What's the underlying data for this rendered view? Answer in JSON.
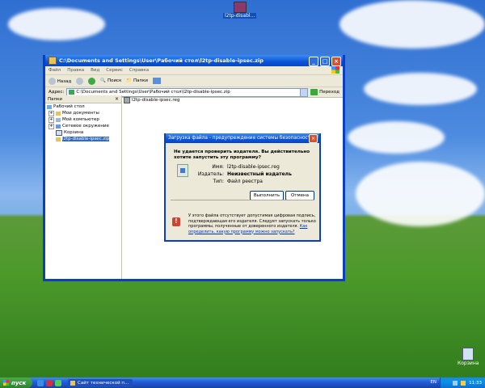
{
  "desktop": {
    "top_icon_label": "l2tp-disabl...",
    "recycle_bin_label": "Корзина"
  },
  "explorer": {
    "title": "C:\\Documents and Settings\\User\\Рабочий стол\\l2tp-disable-ipsec.zip",
    "menu": [
      "Файл",
      "Правка",
      "Вид",
      "Сервис",
      "Справка"
    ],
    "toolbar": {
      "back": "Назад",
      "search": "Поиск",
      "folders": "Папки"
    },
    "address_label": "Адрес:",
    "address_value": "C:\\Documents and Settings\\User\\Рабочий стол\\l2tp-disable-ipsec.zip",
    "go_label": "Переход",
    "folders_pane_header": "Папки",
    "tree": [
      {
        "label": "Рабочий стол",
        "expander": ""
      },
      {
        "label": "Мои документы",
        "expander": "+"
      },
      {
        "label": "Мой компьютер",
        "expander": "+"
      },
      {
        "label": "Сетевое окружение",
        "expander": "+"
      },
      {
        "label": "Корзина",
        "expander": ""
      },
      {
        "label": "l2tp-disable-ipsec.zip",
        "expander": ""
      }
    ],
    "file": "l2tp-disable-ipsec.reg"
  },
  "dialog": {
    "title": "Загрузка файла - предупреждение системы безопасности",
    "question": "Не удается проверить издателя. Вы действительно хотите запустить эту программу?",
    "name_label": "Имя:",
    "name_value": "l2tp-disable-ipsec.reg",
    "publisher_label": "Издатель:",
    "publisher_value": "Неизвестный издатель",
    "type_label": "Тип:",
    "type_value": "Файл реестра",
    "run_button": "Выполнить",
    "cancel_button": "Отмена",
    "warning_text": "У этого файла отсутствует допустимая цифровая подпись, подтверждающая его издателя. Следует запускать только программы, полученные от доверенного издателя.",
    "warning_link": "Как определить, какую программу можно запускать?"
  },
  "taskbar": {
    "start_label": "пуск",
    "task_label": "Сайт технической п...",
    "language": "EN",
    "clock": "11:33"
  }
}
